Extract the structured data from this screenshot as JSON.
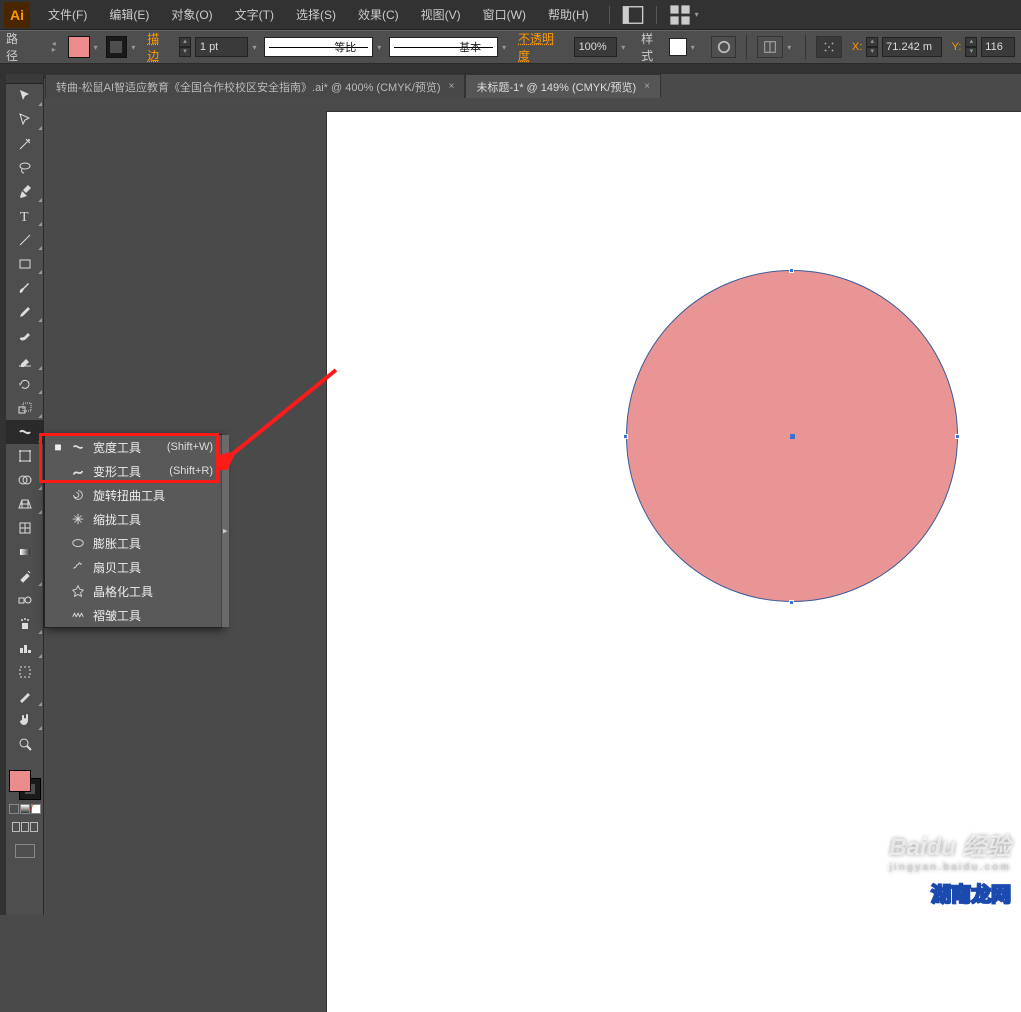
{
  "menubar": {
    "logo": "Ai",
    "items": [
      "文件(F)",
      "编辑(E)",
      "对象(O)",
      "文字(T)",
      "选择(S)",
      "效果(C)",
      "视图(V)",
      "窗口(W)",
      "帮助(H)"
    ]
  },
  "controlbar": {
    "path_label": "路径",
    "stroke_label": "描边",
    "stroke_weight": "1 pt",
    "profile_label": "等比",
    "brush_label": "基本",
    "opacity_label": "不透明度",
    "opacity_value": "100%",
    "style_label": "样式",
    "x_label": "X:",
    "x_value": "71.242 m",
    "y_label": "Y:",
    "y_value": "116"
  },
  "tabs": {
    "tab1": "转曲-松鼠AI智适应教育《全国合作校校区安全指南》.ai* @ 400% (CMYK/预览)",
    "tab2": "未标题-1* @ 149% (CMYK/预览)",
    "close": "×"
  },
  "flyout": {
    "items": [
      {
        "label": "宽度工具",
        "shortcut": "(Shift+W)",
        "selected": true
      },
      {
        "label": "变形工具",
        "shortcut": "(Shift+R)",
        "selected": false
      },
      {
        "label": "旋转扭曲工具",
        "shortcut": "",
        "selected": false
      },
      {
        "label": "缩拢工具",
        "shortcut": "",
        "selected": false
      },
      {
        "label": "膨胀工具",
        "shortcut": "",
        "selected": false
      },
      {
        "label": "扇贝工具",
        "shortcut": "",
        "selected": false
      },
      {
        "label": "晶格化工具",
        "shortcut": "",
        "selected": false
      },
      {
        "label": "褶皱工具",
        "shortcut": "",
        "selected": false
      }
    ]
  },
  "watermark": {
    "baidu": "Baidu 经验",
    "baidu_sub": "jingyan.baidu.com",
    "site": "湖南龙网"
  }
}
